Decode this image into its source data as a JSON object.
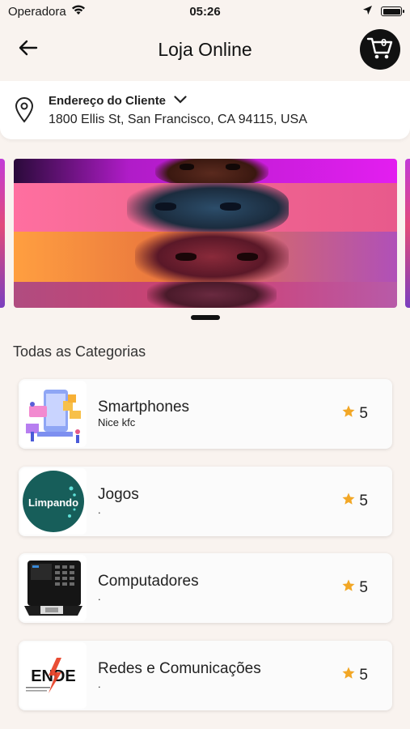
{
  "status_bar": {
    "carrier": "Operadora",
    "time": "05:26"
  },
  "header": {
    "title": "Loja Online",
    "cart_count": "0"
  },
  "address": {
    "label": "Endereço do Cliente",
    "value": "1800 Ellis St, San Francisco, CA 94115, USA"
  },
  "section": {
    "title": "Todas as Categorias"
  },
  "categories": [
    {
      "name": "Smartphones",
      "subtitle": "Nice kfc",
      "rating": "5",
      "thumb_icon": "smartphone-illustration-icon"
    },
    {
      "name": "Jogos",
      "subtitle": ".",
      "rating": "5",
      "thumb_icon": "limpando-logo-icon",
      "thumb_text": "Limpando"
    },
    {
      "name": "Computadores",
      "subtitle": ".",
      "rating": "5",
      "thumb_icon": "time-clock-device-icon"
    },
    {
      "name": "Redes e Comunicações",
      "subtitle": ".",
      "rating": "5",
      "thumb_icon": "ende-logo-icon",
      "thumb_text": "ENDE"
    }
  ],
  "colors": {
    "background": "#f9f3ef",
    "star": "#f2a726",
    "cart_bg": "#111111",
    "limpando_bg": "#175e5a"
  }
}
